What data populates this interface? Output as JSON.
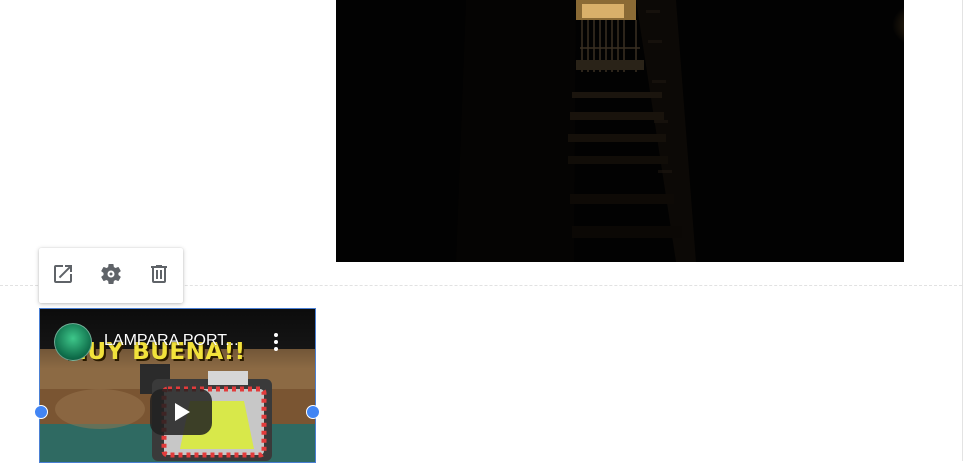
{
  "canvas": {
    "alley_image": {
      "kind": "photo",
      "description_icon": "image"
    },
    "toolbar": {
      "open_icon": "open-in-new-icon",
      "settings_icon": "settings-gear-icon",
      "delete_icon": "trash-icon"
    },
    "video": {
      "title": "LAMPARA PORT...",
      "thumbnail_caption": "MUY BUENA!!",
      "play_icon": "play-icon",
      "menu_icon": "kebab-menu-icon"
    }
  },
  "colors": {
    "selection_border": "#4a7fd3",
    "resize_handle": "#4285f4",
    "toolbar_icon": "#5f6368",
    "thumbnail_caption": "#f2e23b"
  }
}
